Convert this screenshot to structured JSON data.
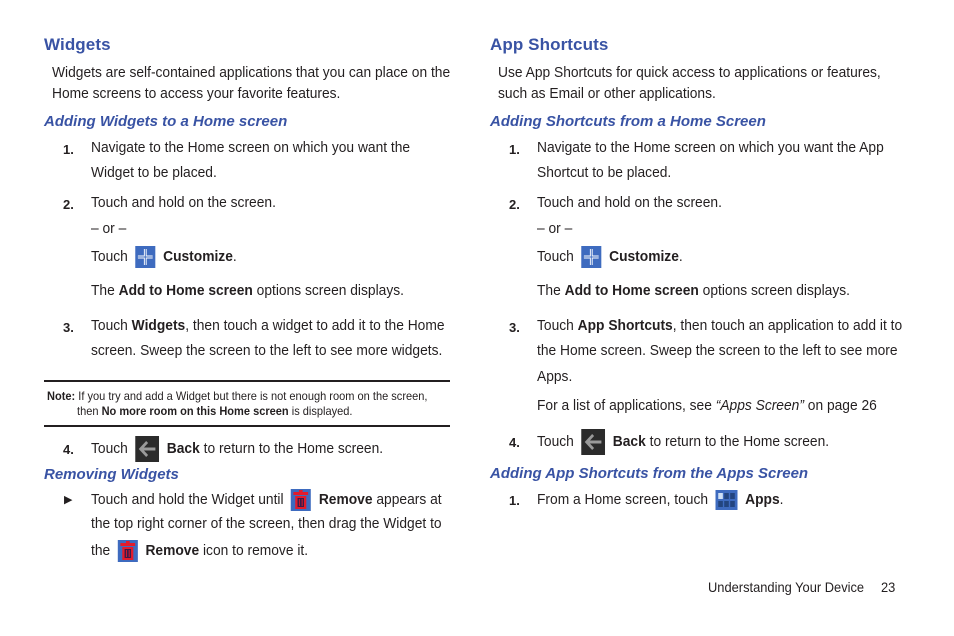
{
  "left": {
    "title": "Widgets",
    "intro": [
      "Widgets are self-contained applications that you can place on the",
      "Home screens to access your favorite features."
    ],
    "sub1": "Adding Widgets to a Home screen",
    "steps": {
      "s1": {
        "num": "1.",
        "lines": [
          "Navigate to the Home screen on which you want the",
          "Widget to be placed."
        ]
      },
      "s2": {
        "num": "2.",
        "text": "Touch and hold on the screen.",
        "or": "– or –",
        "touch": "Touch",
        "customize": "Customize",
        "period": ".",
        "the": "The",
        "add_home": "Add to Home screen",
        "displays": "options screen displays."
      },
      "s3": {
        "num": "3.",
        "touch": "Touch",
        "widgets": "Widgets",
        "rest1": ", then touch a widget to add it to the Home",
        "line2": "screen. Sweep the screen to the left to see more widgets."
      },
      "s4": {
        "num": "4.",
        "touch": "Touch",
        "back": "Back",
        "rest": "to return to the Home screen."
      }
    },
    "note": {
      "label": "Note:",
      "line1": "If you try and add a Widget but there is not enough room on the screen,",
      "then": "then",
      "bold": "No more room on this Home screen",
      "end": "is displayed."
    },
    "sub2": "Removing Widgets",
    "bullet": {
      "marker": "▶",
      "l1a": "Touch and hold the Widget until",
      "remove": "Remove",
      "l1b": "appears at",
      "l2": "the top right corner of the screen, then drag the Widget to",
      "l3a": "the",
      "l3b": "icon to remove it."
    }
  },
  "right": {
    "title": "App Shortcuts",
    "intro": [
      "Use App Shortcuts for quick access to applications or features,",
      "such as Email or other applications."
    ],
    "sub1": "Adding Shortcuts from a Home Screen",
    "steps": {
      "s1": {
        "num": "1.",
        "lines": [
          "Navigate to the Home screen on which you want the App",
          "Shortcut to be placed."
        ]
      },
      "s2": {
        "num": "2.",
        "text": "Touch and hold on the screen.",
        "or": "– or –",
        "touch": "Touch",
        "customize": "Customize",
        "period": ".",
        "the": "The",
        "add_home": "Add to Home screen",
        "displays": "options screen displays."
      },
      "s3": {
        "num": "3.",
        "touch": "Touch",
        "app_shortcuts": "App Shortcuts",
        "rest1": ", then touch an application to add it to",
        "line2": "the Home screen. Sweep the screen to the left to see more",
        "line3": "Apps.",
        "see": "For a list of applications, see",
        "link": "“Apps Screen”",
        "page": "on page 26"
      },
      "s4": {
        "num": "4.",
        "touch": "Touch",
        "back": "Back",
        "rest": "to return to the Home screen."
      }
    },
    "sub2": "Adding App Shortcuts from the Apps Screen",
    "step_apps": {
      "num": "1.",
      "text": "From a Home screen, touch",
      "apps": "Apps",
      "period": "."
    }
  },
  "footer": {
    "section": "Understanding Your Device",
    "page": "23"
  },
  "colors": {
    "heading": "#3953a4",
    "icon_blue": "#3e6bbf",
    "icon_dark": "#2b2b2b",
    "trash_red": "#e21b2c"
  }
}
